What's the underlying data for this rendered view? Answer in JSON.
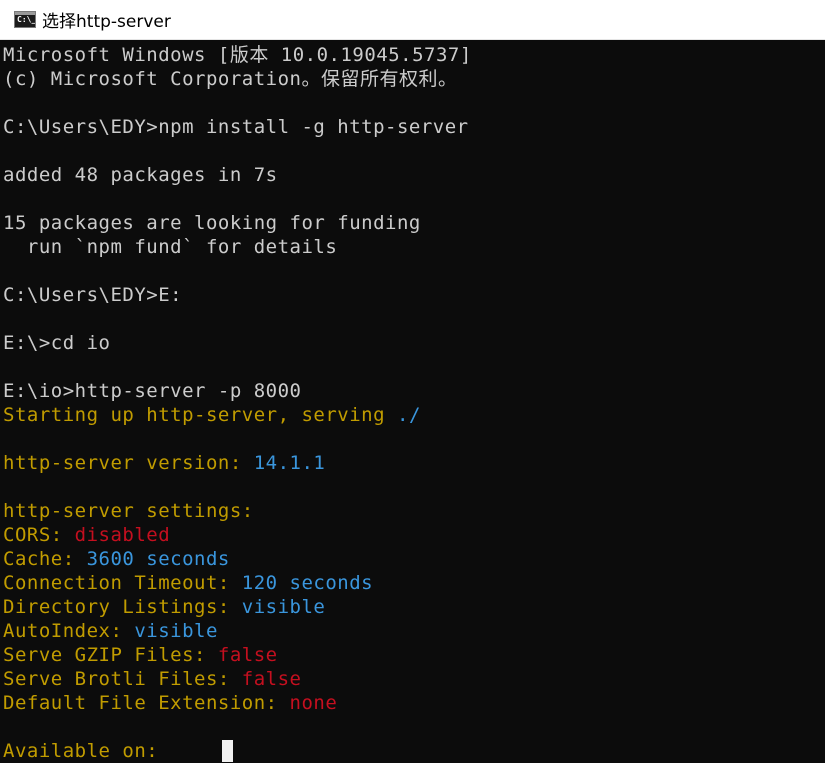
{
  "window": {
    "title": "选择http-server",
    "icon_glyph": "C:\\_"
  },
  "colors": {
    "background": "#0c0c0c",
    "default_text": "#cccccc",
    "yellow": "#c19c00",
    "cyan": "#3a96dd",
    "red": "#c50f1f"
  },
  "console": {
    "l1": "Microsoft Windows [版本 10.0.19045.5737]",
    "l2": "(c) Microsoft Corporation。保留所有权利。",
    "l3": "C:\\Users\\EDY>npm install -g http-server",
    "l4": "added 48 packages in 7s",
    "l5": "15 packages are looking for funding",
    "l6": "  run `npm fund` for details",
    "l7": "C:\\Users\\EDY>E:",
    "l8": "E:\\>cd io",
    "l9": "E:\\io>http-server -p 8000",
    "l10": "Starting up http-server, serving ",
    "l10_path": "./",
    "l11": "http-server version: ",
    "l11_value": "14.1.1",
    "l12": "http-server settings: ",
    "s1_label": "CORS: ",
    "s1_value": "disabled",
    "s2_label": "Cache: ",
    "s2_value": "3600 seconds",
    "s3_label": "Connection Timeout: ",
    "s3_value": "120 seconds",
    "s4_label": "Directory Listings: ",
    "s4_value": "visible",
    "s5_label": "AutoIndex: ",
    "s5_value": "visible",
    "s6_label": "Serve GZIP Files: ",
    "s6_value": "false",
    "s7_label": "Serve Brotli Files: ",
    "s7_value": "false",
    "s8_label": "Default File Extension: ",
    "s8_value": "none",
    "available": "Available on:"
  }
}
